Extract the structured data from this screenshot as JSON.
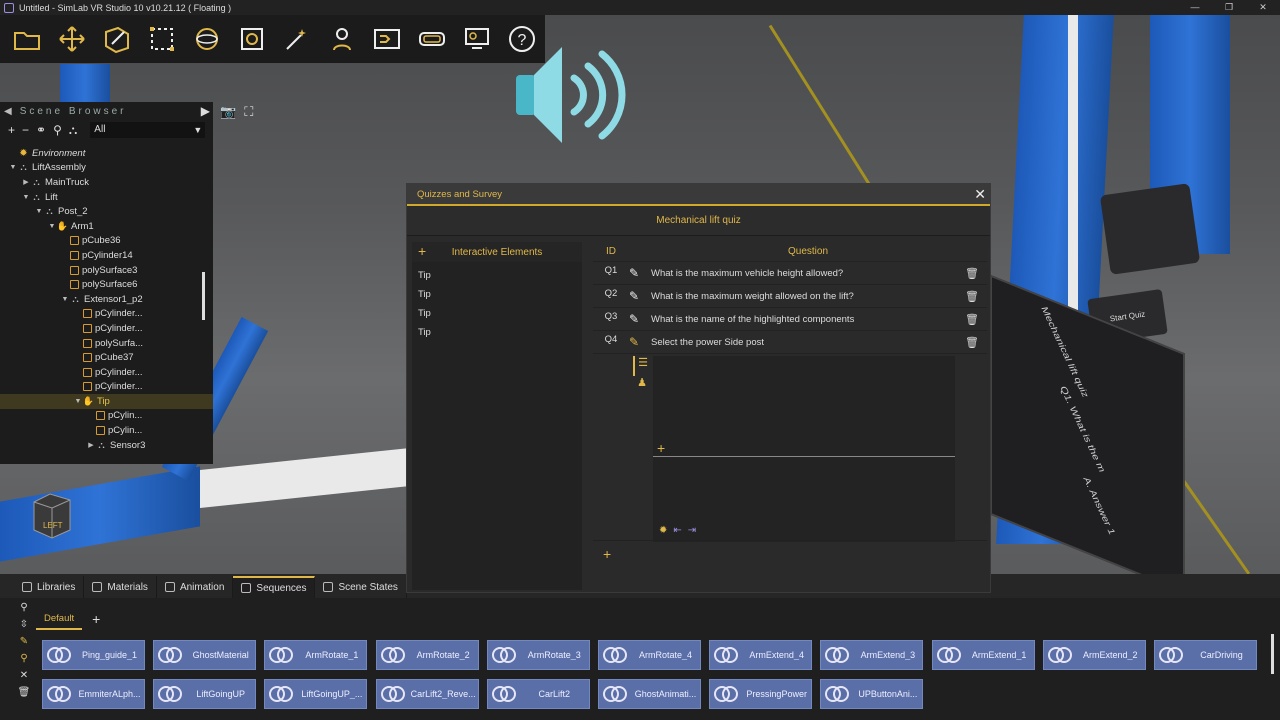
{
  "window": {
    "title": "Untitled - SimLab VR Studio 10 v10.21.12 ( Floating )",
    "controls": [
      "—",
      "❐",
      "✕"
    ]
  },
  "toolbar": {
    "icons": [
      "open-folder-icon",
      "move-icon",
      "edit-icon",
      "selection-box-icon",
      "globe-icon",
      "media-icon",
      "magic-wand-icon",
      "user-icon",
      "sequence-icon",
      "vr-headset-icon",
      "presentation-icon",
      "help-icon"
    ]
  },
  "scene_browser": {
    "title": "Scene Browser",
    "filter": "All",
    "items": [
      {
        "label": "Environment",
        "indent": 0,
        "type": "env",
        "twisty": "",
        "italic": true
      },
      {
        "label": "LiftAssembly",
        "indent": 0,
        "type": "grp",
        "twisty": "▼"
      },
      {
        "label": "MainTruck",
        "indent": 1,
        "type": "grp",
        "twisty": "▶"
      },
      {
        "label": "Lift",
        "indent": 1,
        "type": "grp",
        "twisty": "▼"
      },
      {
        "label": "Post_2",
        "indent": 2,
        "type": "grp",
        "twisty": "▼"
      },
      {
        "label": "Arm1",
        "indent": 3,
        "type": "hand",
        "twisty": "▼"
      },
      {
        "label": "pCube36",
        "indent": 4,
        "type": "mesh",
        "twisty": ""
      },
      {
        "label": "pCylinder14",
        "indent": 4,
        "type": "mesh",
        "twisty": ""
      },
      {
        "label": "polySurface3",
        "indent": 4,
        "type": "mesh",
        "twisty": ""
      },
      {
        "label": "polySurface6",
        "indent": 4,
        "type": "mesh",
        "twisty": ""
      },
      {
        "label": "Extensor1_p2",
        "indent": 4,
        "type": "grp",
        "twisty": "▼"
      },
      {
        "label": "pCylinder...",
        "indent": 5,
        "type": "mesh",
        "twisty": ""
      },
      {
        "label": "pCylinder...",
        "indent": 5,
        "type": "mesh",
        "twisty": ""
      },
      {
        "label": "polySurfa...",
        "indent": 5,
        "type": "mesh",
        "twisty": ""
      },
      {
        "label": "pCube37",
        "indent": 5,
        "type": "mesh",
        "twisty": ""
      },
      {
        "label": "pCylinder...",
        "indent": 5,
        "type": "mesh",
        "twisty": ""
      },
      {
        "label": "pCylinder...",
        "indent": 5,
        "type": "mesh",
        "twisty": ""
      },
      {
        "label": "Tip",
        "indent": 5,
        "type": "hand",
        "twisty": "▼",
        "selected": true
      },
      {
        "label": "pCylin...",
        "indent": 6,
        "type": "mesh",
        "twisty": ""
      },
      {
        "label": "pCylin...",
        "indent": 6,
        "type": "mesh",
        "twisty": ""
      },
      {
        "label": "Sensor3",
        "indent": 6,
        "type": "grp",
        "twisty": "▶"
      }
    ]
  },
  "quiz_dialog": {
    "title": "Quizzes and Survey",
    "quiz_name": "Mechanical lift quiz",
    "interactive_elements_label": "Interactive Elements",
    "interactive_elements": [
      "Tip",
      "Tip",
      "Tip",
      "Tip"
    ],
    "columns": {
      "id": "ID",
      "question": "Question"
    },
    "questions": [
      {
        "id": "Q1",
        "text": "What is the maximum vehicle height allowed?"
      },
      {
        "id": "Q2",
        "text": "What is the maximum weight allowed on the lift?"
      },
      {
        "id": "Q3",
        "text": "What is the name of the highlighted components"
      },
      {
        "id": "Q4",
        "text": "Select the power Side post"
      }
    ],
    "add_symbol": "+"
  },
  "bottom_panel": {
    "tabs": [
      {
        "label": "Libraries",
        "active": false
      },
      {
        "label": "Materials",
        "active": false
      },
      {
        "label": "Animation",
        "active": false
      },
      {
        "label": "Sequences",
        "active": true
      },
      {
        "label": "Scene States",
        "active": false
      }
    ],
    "sub_tab": "Default",
    "sequences_row1": [
      "Ping_guide_1",
      "GhostMaterial",
      "ArmRotate_1",
      "ArmRotate_2",
      "ArmRotate_3",
      "ArmRotate_4",
      "ArmExtend_4",
      "ArmExtend_3",
      "ArmExtend_1",
      "ArmExtend_2",
      "CarDriving"
    ],
    "sequences_row2": [
      "EmmiterALph...",
      "LiftGoingUP",
      "LiftGoingUP_...",
      "CarLift2_Reve...",
      "CarLift2",
      "GhostAnimati...",
      "PressingPower",
      "UPButtonAni..."
    ]
  },
  "viewport": {
    "nav_cube_label": "LEFT",
    "panel_text": [
      "Mechanical lift quiz",
      "Q1. What is the m",
      "A. Answer 1"
    ],
    "button_label": "Start Quiz"
  }
}
